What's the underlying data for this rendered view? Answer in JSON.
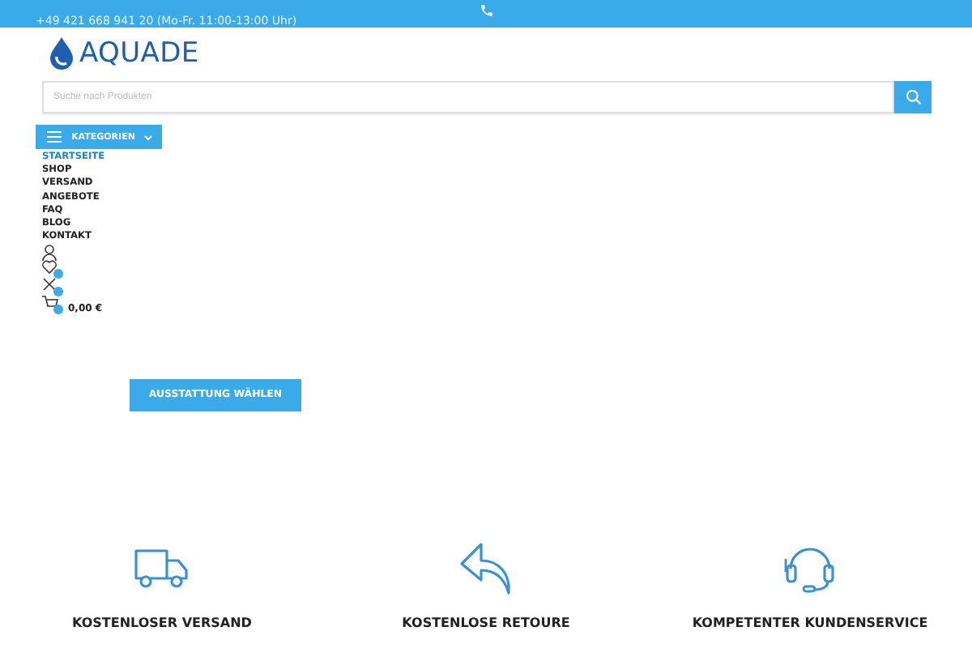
{
  "top_bar": {
    "phone": "+49 421 668 941 20 (Mo-Fr. 11:00-13:00 Uhr)"
  },
  "logo": {
    "text": "AQUADE"
  },
  "search": {
    "placeholder": "Suche nach Produkten"
  },
  "categories_button": {
    "label": "KATEGORIEN"
  },
  "nav": [
    {
      "label": "STARTSEITE",
      "selected": true
    },
    {
      "label": "SHOP",
      "selected": false
    },
    {
      "label": "VERSAND",
      "selected": false
    },
    {
      "label": "ANGEBOTE",
      "selected": false
    },
    {
      "label": "FAQ",
      "selected": false
    },
    {
      "label": "BLOG",
      "selected": false
    },
    {
      "label": "KONTAKT",
      "selected": false
    }
  ],
  "header_icons": [
    {
      "kind": "account"
    },
    {
      "kind": "wishlist"
    },
    {
      "kind": "compare"
    },
    {
      "kind": "cart",
      "amount": "0,00 €"
    }
  ],
  "cta_button": {
    "label": "AUSSTATTUNG WÄHLEN"
  },
  "features": [
    {
      "kind": "truck",
      "title": "KOSTENLOSER VERSAND"
    },
    {
      "kind": "return",
      "title": "KOSTENLOSE RETOURE"
    },
    {
      "kind": "headset",
      "title": "KOMPETENTER KUNDENSERVICE"
    }
  ]
}
